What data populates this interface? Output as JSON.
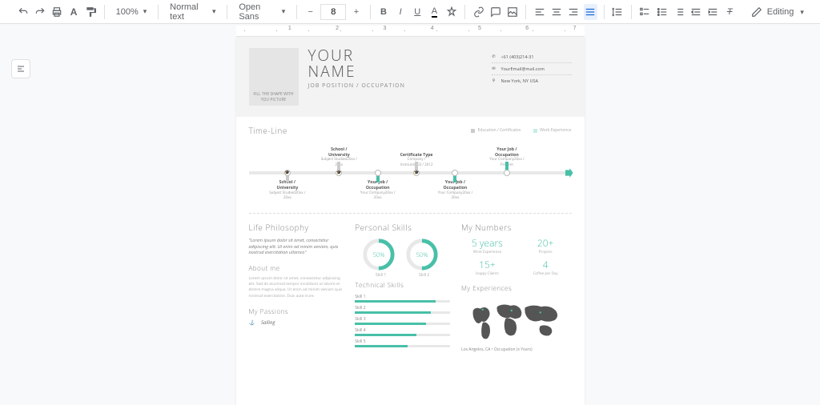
{
  "toolbar": {
    "zoom": "100%",
    "styles": "Normal text",
    "font": "Open Sans",
    "font_size": "8",
    "modeLabel": "Editing"
  },
  "ruler": [
    "",
    "1",
    "2",
    "3",
    "4",
    "5",
    "6",
    "7"
  ],
  "header": {
    "photo_placeholder": "FILL THE SHAPE WITH YOU PICTURE",
    "name_line1": "YOUR",
    "name_line2": "NAME",
    "job": "JOB POSITION / OCCUPATION",
    "contacts": [
      {
        "icon": "phone",
        "text": "+61 (403)214-31"
      },
      {
        "icon": "email",
        "text": "YourEmail@mail.com"
      },
      {
        "icon": "location",
        "text": "New York, NY USA"
      }
    ]
  },
  "timeline": {
    "title": "Time-Line",
    "legend_edu": "Education / Certificates",
    "legend_work": "Work Experience",
    "items": [
      {
        "pos": 12,
        "side": "bot",
        "type": "edu",
        "title": "School / University",
        "sub": "Subject Studied",
        "dates": "20xx / 20xx"
      },
      {
        "pos": 28,
        "side": "top",
        "type": "edu",
        "title": "School / University",
        "sub": "Subject Studied",
        "dates": "20xx / 20xx"
      },
      {
        "pos": 40,
        "side": "bot",
        "type": "work",
        "title": "Your Job / Occupation",
        "sub": "Your Company",
        "dates": "20xx / 20xx"
      },
      {
        "pos": 52,
        "side": "top",
        "type": "edu",
        "title": "Certificate Type",
        "sub": "Company / Institution",
        "dates": "03 / 2012"
      },
      {
        "pos": 64,
        "side": "bot",
        "type": "work",
        "title": "Your Job / Occupation",
        "sub": "Your Company",
        "dates": "20xx / 20xx"
      },
      {
        "pos": 80,
        "side": "top",
        "type": "work",
        "title": "Your Job / Occupation",
        "sub": "Your Company",
        "dates": "20xx / Present"
      }
    ]
  },
  "col1": {
    "philosophy_title": "Life Philosophy",
    "quote": "\"Lorem ipsum dolor sit amet, consectetur adipiscing elit. Ut enim ad minim veniam, quis nostrud exercitation ullamco\"",
    "about_title": "About me",
    "about_text": "Lorem ipsum dolor sit amet, consectetur adipiscing elit. Sed do eiusmod tempor incididunt ut labore et dolore magna aliqua. Ut enim ad minim veniam quis nostrud exercitation. Duis aute irure.",
    "passions_title": "My Passions",
    "passion1": "Sailing"
  },
  "col2": {
    "personal_title": "Personal Skills",
    "donuts": [
      {
        "pct": 50,
        "label": "Skill 1"
      },
      {
        "pct": 50,
        "label": "Skill 2"
      }
    ],
    "technical_title": "Technical Skills",
    "skills": [
      {
        "name": "Skill 1",
        "pct": 85
      },
      {
        "name": "Skill 2",
        "pct": 80
      },
      {
        "name": "Skill 3",
        "pct": 75
      },
      {
        "name": "Skill 4",
        "pct": 65
      },
      {
        "name": "Skill 5",
        "pct": 55
      }
    ]
  },
  "col3": {
    "numbers_title": "My Numbers",
    "numbers": [
      {
        "big": "5 years",
        "small": "Work Experience"
      },
      {
        "big": "20+",
        "small": "Projects"
      },
      {
        "big": "15+",
        "small": "Happy Clients"
      },
      {
        "big": "4",
        "small": "Coffee per Day"
      }
    ],
    "exp_title": "My Experiences",
    "exp_caption": "Los Angeles, CA • Occupation (x Years)"
  },
  "chart_data": [
    {
      "type": "pie",
      "title": "Skill 1",
      "values": [
        50,
        50
      ],
      "categories": [
        "filled",
        "remaining"
      ]
    },
    {
      "type": "pie",
      "title": "Skill 2",
      "values": [
        50,
        50
      ],
      "categories": [
        "filled",
        "remaining"
      ]
    },
    {
      "type": "bar",
      "title": "Technical Skills",
      "categories": [
        "Skill 1",
        "Skill 2",
        "Skill 3",
        "Skill 4",
        "Skill 5"
      ],
      "values": [
        85,
        80,
        75,
        65,
        55
      ],
      "xlabel": "",
      "ylabel": "",
      "ylim": [
        0,
        100
      ]
    }
  ]
}
